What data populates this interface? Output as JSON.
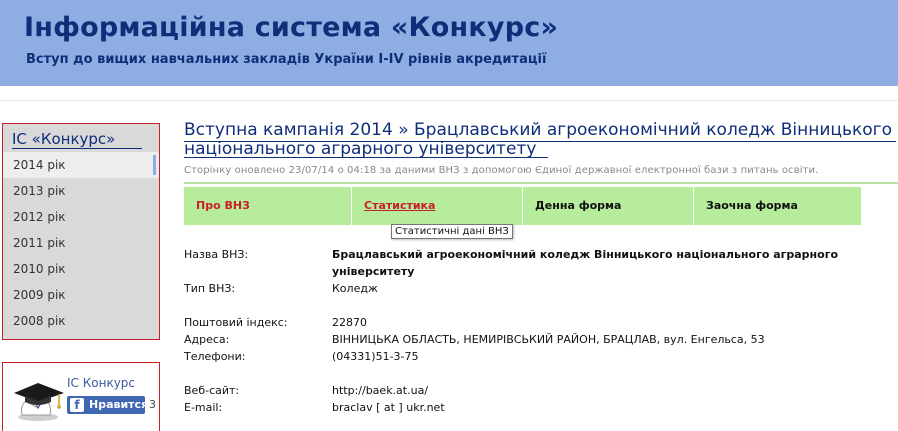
{
  "header": {
    "title": "Інформаційна система «Конкурс»",
    "subtitle": "Вступ до вищих навчальних закладів України I-IV рівнів акредитації"
  },
  "sidebar": {
    "title": "ІС «Конкурс»",
    "years": [
      "2014 рік",
      "2013 рік",
      "2012 рік",
      "2011 рік",
      "2010 рік",
      "2009 рік",
      "2008 рік"
    ],
    "active_year": "2014 рік"
  },
  "like_box": {
    "name": "ІС Конкурс",
    "button_label": "Нравится",
    "count": "3"
  },
  "main": {
    "title": "Вступна кампанія 2014 » Брацлавський агроекономічний коледж Вінницького національного аграрного університету",
    "updated": "Сторінку оновлено 23/07/14 о 04:18 за даними ВНЗ з допомогою Єдиної державної електронної бази з питань освіти.",
    "tabs": [
      "Про ВНЗ",
      "Статистика",
      "Денна форма",
      "Заочна форма"
    ],
    "tooltip": "Статистичні дані ВНЗ",
    "info": {
      "name_label": "Назва ВНЗ:",
      "name_value": "Брацлавський агроекономічний коледж Вінницького національного аграрного університету",
      "type_label": "Тип ВНЗ:",
      "type_value": "Коледж",
      "postcode_label": "Поштовий індекс:",
      "postcode_value": "22870",
      "address_label": "Адреса:",
      "address_value": "ВІННИЦЬКА ОБЛАСТЬ, НЕМИРІВСЬКИЙ РАЙОН, БРАЦЛАВ, вул. Енгельса, 53",
      "phone_label": "Телефони:",
      "phone_value": "(04331)51-3-75",
      "website_label": "Веб-сайт:",
      "website_value": "http://baek.at.ua/",
      "email_label": "E-mail:",
      "email_value": "braclav [ at ] ukr.net"
    }
  },
  "colors": {
    "header_bg": "#8eaee3",
    "title_blue": "#0f2e7a",
    "accent_red": "#c8202a",
    "tab_green": "#b7ec9c",
    "sidebar_bg": "#d9d9d9",
    "fb_blue": "#4267b2"
  },
  "icons": {
    "graduation_cap": "graduation-cap-icon",
    "facebook": "facebook-icon"
  }
}
